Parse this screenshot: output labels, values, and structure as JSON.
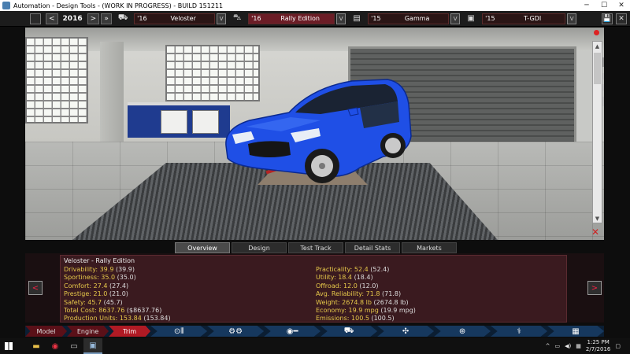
{
  "window": {
    "title": "Automation - Design Tools - (WORK IN PROGRESS) - BUILD 151211",
    "minimize": "─",
    "maximize": "☐",
    "close": "✕"
  },
  "toolbar": {
    "prev_year": "<",
    "year": "2016",
    "next_year": ">",
    "fields": [
      {
        "icon": "car-model-icon",
        "year": "'16",
        "name": "Veloster",
        "active": false
      },
      {
        "icon": "car-trim-icon",
        "year": "'16",
        "name": "Rally Edition",
        "active": true
      },
      {
        "icon": "engine-family-icon",
        "year": "'15",
        "name": "Gamma",
        "active": false
      },
      {
        "icon": "engine-variant-icon",
        "year": "'15",
        "name": "T-GDI",
        "active": false
      }
    ],
    "dropdown_glyph": "V"
  },
  "viewport": {
    "scroll_up": "▲",
    "scroll_down": "▼",
    "close_glyph": "✕"
  },
  "tabs": [
    {
      "label": "Overview",
      "active": true
    },
    {
      "label": "Design",
      "active": false
    },
    {
      "label": "Test Track",
      "active": false
    },
    {
      "label": "Detail Stats",
      "active": false
    },
    {
      "label": "Markets",
      "active": false
    }
  ],
  "stats": {
    "header": "Veloster - Rally Edition",
    "left": [
      {
        "label": "Drivability:",
        "value": "39.9",
        "base": "(39.9)"
      },
      {
        "label": "Sportiness:",
        "value": "35.0",
        "base": "(35.0)"
      },
      {
        "label": "Comfort:",
        "value": "27.4",
        "base": "(27.4)"
      },
      {
        "label": "Prestige:",
        "value": "21.0",
        "base": "(21.0)"
      },
      {
        "label": "Safety:",
        "value": "45.7",
        "base": "(45.7)"
      },
      {
        "label": "Total Cost:",
        "value": "8637.76",
        "base": "($8637.76)"
      },
      {
        "label": "Production Units:",
        "value": "153.84",
        "base": "(153.84)"
      }
    ],
    "right": [
      {
        "label": "Practicality:",
        "value": "52.4",
        "base": "(52.4)"
      },
      {
        "label": "Utility:",
        "value": "18.4",
        "base": "(18.4)"
      },
      {
        "label": "Offroad:",
        "value": "12.0",
        "base": "(12.0)"
      },
      {
        "label": "Avg. Reliability:",
        "value": "71.8",
        "base": "(71.8)"
      },
      {
        "label": "Weight:",
        "value": "2674.8 lb",
        "base": "(2674.8 lb)"
      },
      {
        "label": "Economy:",
        "value": "19.9 mpg",
        "base": "(19.9 mpg)"
      },
      {
        "label": "Emissions:",
        "value": "100.5",
        "base": "(100.5)"
      }
    ],
    "prev": "<",
    "next": ">"
  },
  "workflow": {
    "steps": [
      {
        "label": "Model",
        "kind": "red",
        "active": false
      },
      {
        "label": "Engine",
        "kind": "red",
        "active": false
      },
      {
        "label": "Trim",
        "kind": "red",
        "active": true
      },
      {
        "label": "⊙⫴",
        "kind": "blue",
        "icon": "drivetrain-icon"
      },
      {
        "label": "⚙⚙",
        "kind": "blue",
        "icon": "suspension-icon"
      },
      {
        "label": "◉━",
        "kind": "blue",
        "icon": "wheels-icon"
      },
      {
        "label": "⛟",
        "kind": "blue",
        "icon": "body-icon"
      },
      {
        "label": "✣",
        "kind": "blue",
        "icon": "fan-icon"
      },
      {
        "label": "⊛",
        "kind": "blue",
        "icon": "interior-icon"
      },
      {
        "label": "⚕",
        "kind": "blue",
        "icon": "safety-icon"
      },
      {
        "label": "▦",
        "kind": "blue",
        "icon": "finish-icon"
      }
    ]
  },
  "taskbar": {
    "time": "1:25 PM",
    "date": "2/7/2016",
    "apps": [
      "folder-icon",
      "chrome-icon",
      "media-icon",
      "automation-icon"
    ]
  }
}
